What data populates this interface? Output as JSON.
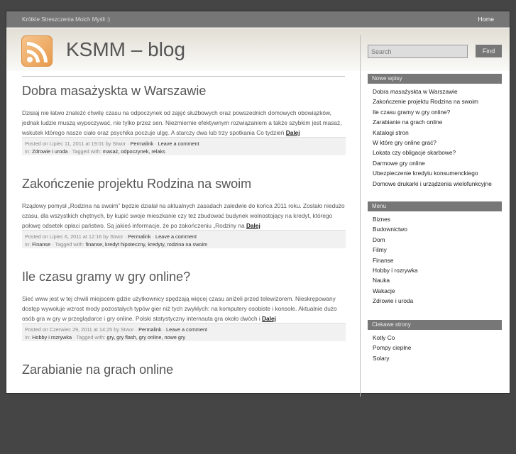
{
  "topbar": {
    "tagline": "Krótkie Streszczenia Moich Myśli :)",
    "home": "Home"
  },
  "header": {
    "title": "KSMM – blog",
    "search_placeholder": "Search",
    "find_label": "Find"
  },
  "posts": [
    {
      "title": "Dobra masażyskta w Warszawie",
      "excerpt": "Dzisiaj nie łatwo znaleźć chwilę czasu na odpoczynek od zajęć służbowych oraz powszednich domowych obowiązków, jednak ludzie muszą wypoczywać, nie tylko przez sen. Niezmiernie efektywnym rozwiązaniem a także szybkim jest masaż, wskutek którego nasze ciało oraz psychika poczuje ulgę. A starczy dwa lub trzy spotkania Co tydzień",
      "more": "Dalej",
      "posted": "Posted on Lipiec 11, 2011 at 19:01 by Stwor · ",
      "permalink": "Permalink",
      "comment": "Leave a comment",
      "in_label": "In: ",
      "category": "Zdrowie i uroda",
      "tagged_label": " · Tagged with: ",
      "tags": "masaż, odpoczynek, relaks"
    },
    {
      "title": "Zakończenie projektu Rodzina na swoim",
      "excerpt": "Rządowy pomysł „Rodzina na swoim” będzie działał na aktualnych zasadach zaledwie do końca 2011 roku. Zostało niedużo czasu, dla wszystkich chętnych, by kupić swoje mieszkanie czy też zbudować budynek wolnostojący na kredyt, którego połowę odsetek opłaci państwo. Są jakieś informacje, że po zakończeniu „Rodziny na",
      "more": "Dalej",
      "posted": "Posted on Lipiec 6, 2011 at 12:16 by Stwor · ",
      "permalink": "Permalink",
      "comment": "Leave a comment",
      "in_label": "In: ",
      "category": "Finanse",
      "tagged_label": " · Tagged with: ",
      "tags": "finanse, kredyt hipoteczny, kredyty, rodzina na swoim"
    },
    {
      "title": "Ile czasu gramy w gry online?",
      "excerpt": "Sieć www jest w tej chwili miejscem gdzie użytkownicy spędzają więcej czasu aniżeli przed telewizorem. Nieskrępowany dostęp wywołuje wzrost mody pozostałych typów gier niż tych zwykłych: na komputery osobiste i konsole. Aktualnie dużo osób gra w gry w przeglądarce i gry online. Polski statystyczny internauta gra około dwóch i",
      "more": "Dalej",
      "posted": "Posted on Czerwiec 29, 2011 at 14:25 by Stwor · ",
      "permalink": "Permalink",
      "comment": "Leave a comment",
      "in_label": "In: ",
      "category": "Hobby i rozrywka",
      "tagged_label": " · Tagged with: ",
      "tags": "gry, gry flash, gry online, nowe gry"
    },
    {
      "title": "Zarabianie na grach online"
    }
  ],
  "sidebar": {
    "recent": {
      "title": "Nowe wpisy",
      "items": [
        "Dobra masażyskta w Warszawie",
        "Zakończenie projektu Rodzina na swoim",
        "Ile czasu gramy w gry online?",
        "Zarabianie na grach online",
        "Katalogi stron",
        "W które gry online grać?",
        "Lokata czy obligacje skarbowe?",
        "Darmowe gry online",
        "Ubezpieczenie kredytu konsumenckiego",
        "Domowe drukarki i urządzenia wielofunkcyjne"
      ]
    },
    "menu": {
      "title": "Menu",
      "items": [
        "Biznes",
        "Budownictwo",
        "Dom",
        "Filmy",
        "Finanse",
        "Hobby i rozrywka",
        "Nauka",
        "Wakacje",
        "Zdrowie i uroda"
      ]
    },
    "links": {
      "title": "Ciekawe strony",
      "items": [
        "Kotły Co",
        "Pompy ciepłne",
        "Solary"
      ]
    }
  }
}
